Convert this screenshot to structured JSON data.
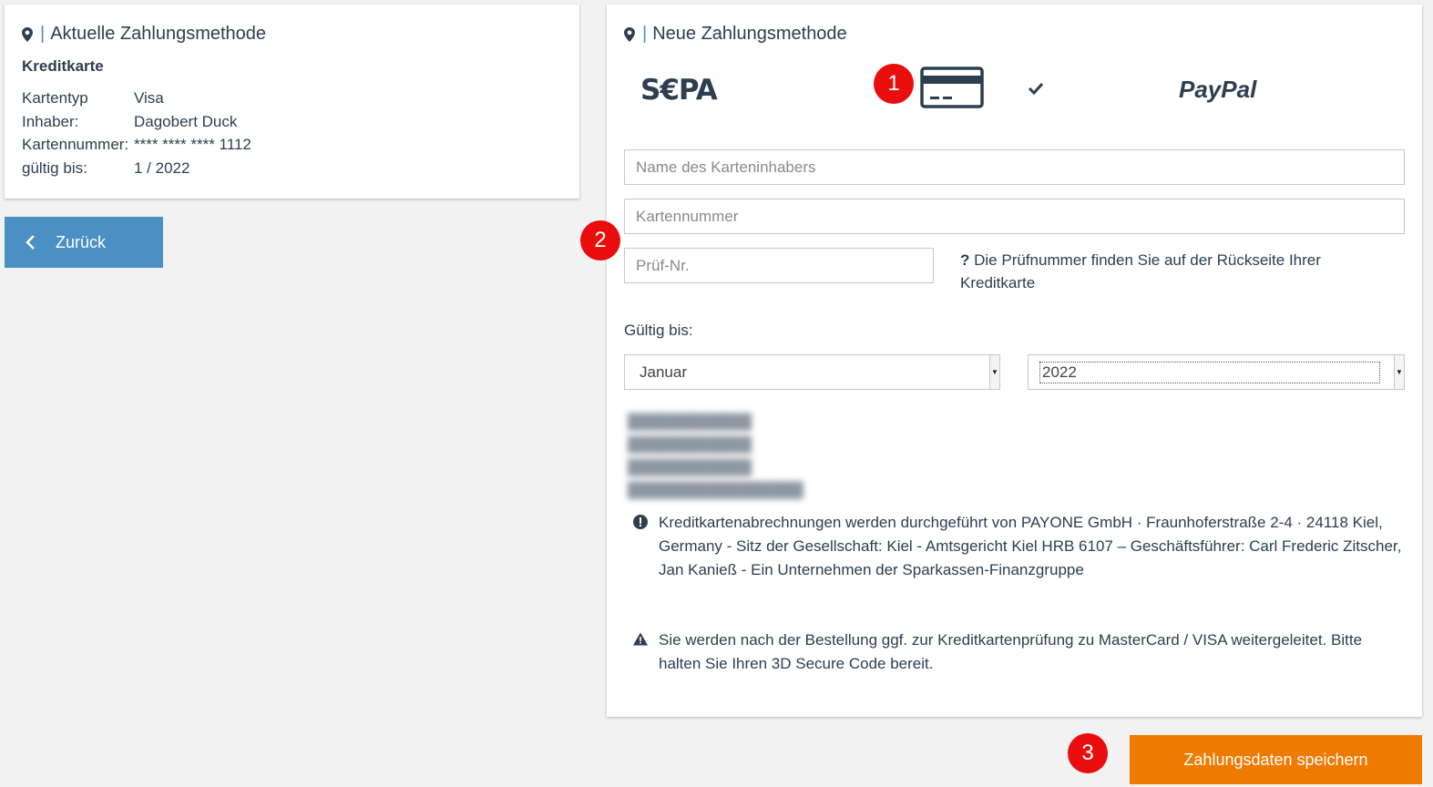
{
  "current": {
    "title": "Aktuelle Zahlungsmethode",
    "type_heading": "Kreditkarte",
    "rows": [
      {
        "label": "Kartentyp",
        "value": "Visa"
      },
      {
        "label": "Inhaber:",
        "value": "Dagobert Duck"
      },
      {
        "label": "Kartennummer:",
        "value": "**** **** **** 1112"
      },
      {
        "label": "gültig bis:",
        "value": "1 / 2022"
      }
    ]
  },
  "back_button": {
    "label": "Zurück"
  },
  "new": {
    "title": "Neue Zahlungsmethode",
    "methods": {
      "sepa": "S€PA",
      "paypal": "PayPal",
      "selected": "credit-card"
    },
    "name_placeholder": "Name des Karteninhabers",
    "number_placeholder": "Kartennummer",
    "cvc_placeholder": "Prüf-Nr.",
    "cvc_help_mark": "?",
    "cvc_help": "Die Prüfnummer finden Sie auf der Rückseite Ihrer Kreditkarte",
    "valid_label": "Gültig bis:",
    "month": "Januar",
    "year": "2022",
    "payone_notice": "Kreditkartenabrechnungen werden durchgeführt von PAYONE GmbH · Fraunhoferstraße 2-4 · 24118 Kiel, Germany - Sitz der Gesellschaft: Kiel - Amtsgericht Kiel HRB 6107 – Geschäftsführer: Carl Frederic Zitscher, Jan Kanieß - Ein Unternehmen der Sparkassen-Finanzgruppe",
    "secure_notice": "Sie werden nach der Bestellung ggf. zur Kreditkartenprüfung zu MasterCard / VISA weitergeleitet. Bitte halten Sie Ihren 3D Secure Code bereit."
  },
  "save_button": {
    "label": "Zahlungsdaten speichern"
  },
  "markers": [
    "1",
    "2",
    "3"
  ],
  "colors": {
    "accent": "#4a90c2",
    "save": "#ef7a00",
    "marker": "#ea0d0d",
    "text": "#2c3e50"
  }
}
